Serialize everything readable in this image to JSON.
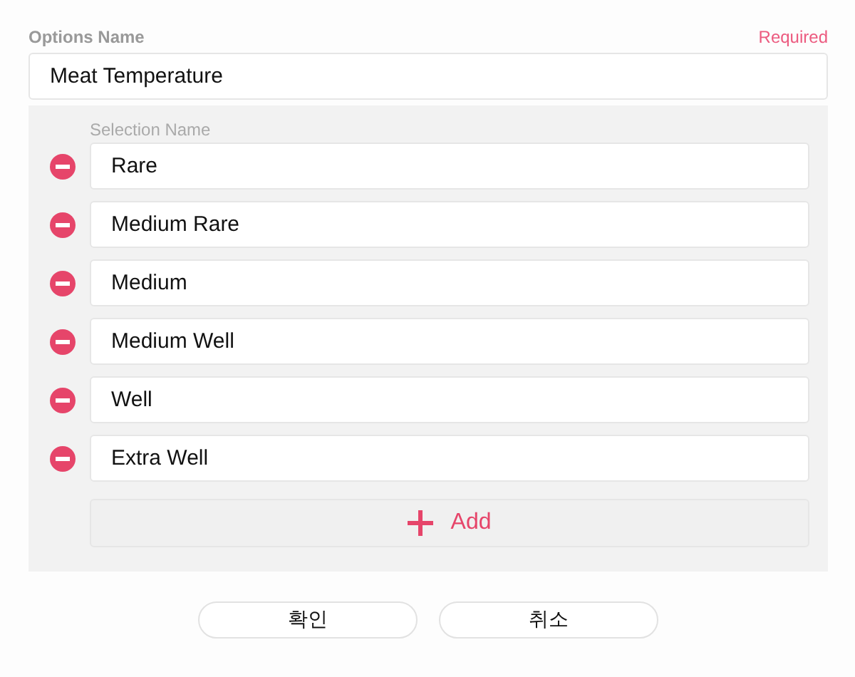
{
  "options_name": {
    "label": "Options Name",
    "required": "Required",
    "value": "Meat Temperature"
  },
  "selections": {
    "label": "Selection Name",
    "items": [
      {
        "value": "Rare"
      },
      {
        "value": "Medium Rare"
      },
      {
        "value": "Medium"
      },
      {
        "value": "Medium Well"
      },
      {
        "value": "Well"
      },
      {
        "value": "Extra Well"
      }
    ],
    "add_button": "Add"
  },
  "buttons": [
    "확인",
    "취소"
  ]
}
